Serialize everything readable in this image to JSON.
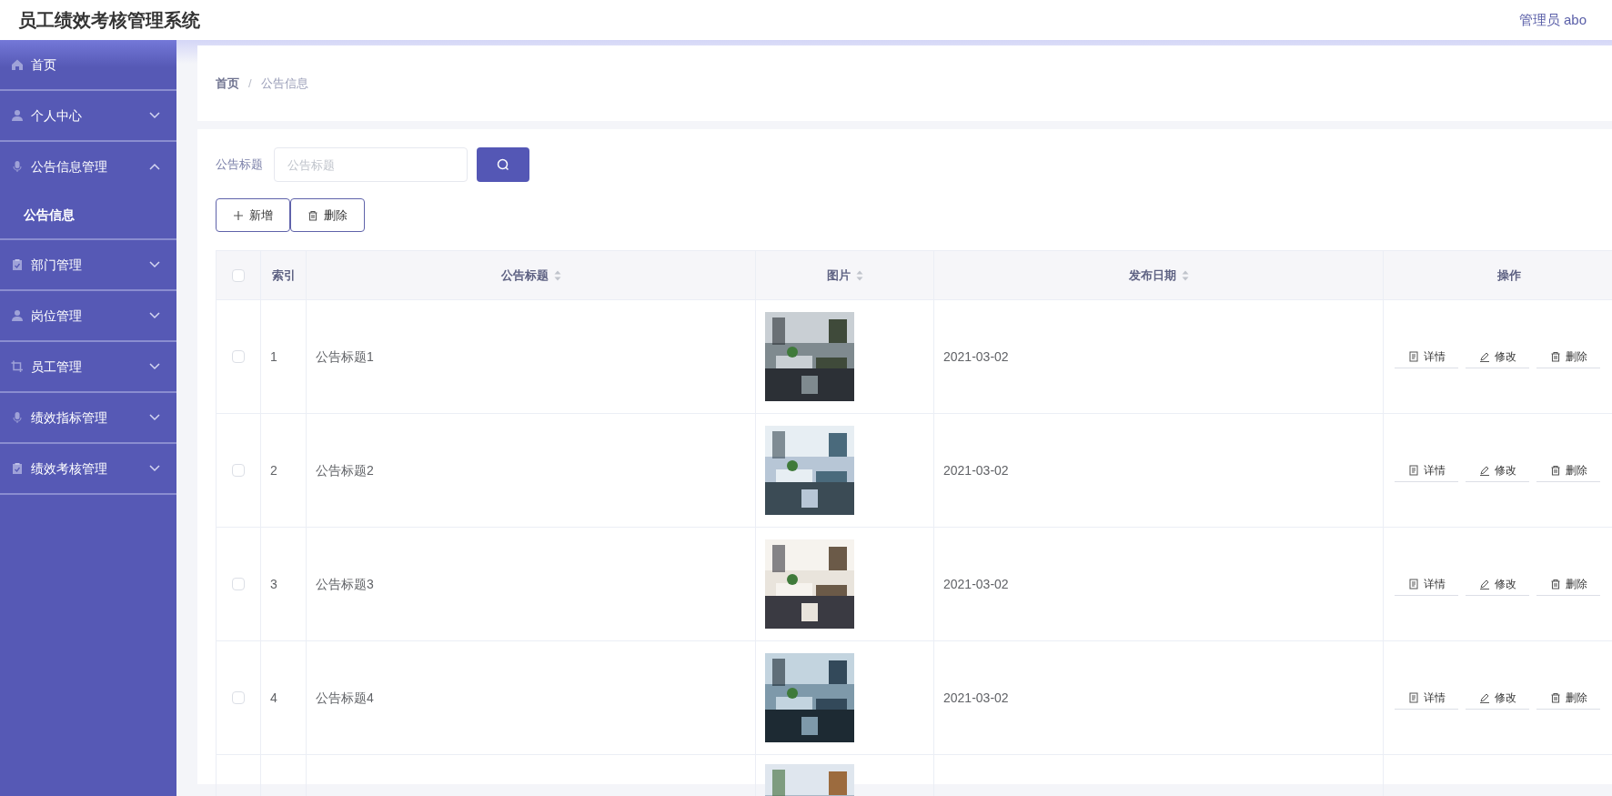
{
  "header": {
    "title": "员工绩效考核管理系统",
    "user": "管理员 abo"
  },
  "sidebar": {
    "items": [
      {
        "label": "首页"
      },
      {
        "label": "个人中心",
        "expanded": false
      },
      {
        "label": "公告信息管理",
        "expanded": true,
        "children": [
          {
            "label": "公告信息",
            "selected": true
          }
        ]
      },
      {
        "label": "部门管理",
        "expanded": false
      },
      {
        "label": "岗位管理",
        "expanded": false
      },
      {
        "label": "员工管理",
        "expanded": false
      },
      {
        "label": "绩效指标管理",
        "expanded": false
      },
      {
        "label": "绩效考核管理",
        "expanded": false
      }
    ]
  },
  "breadcrumb": {
    "items": [
      "首页",
      "公告信息"
    ],
    "separator": "/"
  },
  "search": {
    "label": "公告标题",
    "placeholder": "公告标题"
  },
  "toolbar": [
    {
      "kind": "add",
      "label": "新增"
    },
    {
      "kind": "delete",
      "label": "删除"
    }
  ],
  "table": {
    "all_checked": false,
    "columns": [
      {
        "kind": "check"
      },
      {
        "label": "索引"
      },
      {
        "label": "公告标题",
        "sortable": true
      },
      {
        "label": "图片",
        "sortable": true
      },
      {
        "label": "发布日期",
        "sortable": true
      },
      {
        "label": "操作"
      }
    ],
    "rows": [
      {
        "checked": false,
        "index": "1",
        "title": "公告标题1",
        "image": {
          "kind": "picture"
        },
        "date": "2021-03-02",
        "actions": [
          {
            "kind": "detail",
            "label": "详情"
          },
          {
            "kind": "edit",
            "label": "修改"
          },
          {
            "kind": "delete",
            "label": "删除"
          }
        ]
      },
      {
        "checked": false,
        "index": "2",
        "title": "公告标题2",
        "image": {
          "kind": "picture"
        },
        "date": "2021-03-02",
        "actions": [
          {
            "kind": "detail",
            "label": "详情"
          },
          {
            "kind": "edit",
            "label": "修改"
          },
          {
            "kind": "delete",
            "label": "删除"
          }
        ]
      },
      {
        "checked": false,
        "index": "3",
        "title": "公告标题3",
        "image": {
          "kind": "picture"
        },
        "date": "2021-03-02",
        "actions": [
          {
            "kind": "detail",
            "label": "详情"
          },
          {
            "kind": "edit",
            "label": "修改"
          },
          {
            "kind": "delete",
            "label": "删除"
          }
        ]
      },
      {
        "checked": false,
        "index": "4",
        "title": "公告标题4",
        "image": {
          "kind": "picture"
        },
        "date": "2021-03-02",
        "actions": [
          {
            "kind": "detail",
            "label": "详情"
          },
          {
            "kind": "edit",
            "label": "修改"
          },
          {
            "kind": "delete",
            "label": "删除"
          }
        ]
      },
      {
        "image": {
          "kind": "picture"
        }
      }
    ]
  }
}
